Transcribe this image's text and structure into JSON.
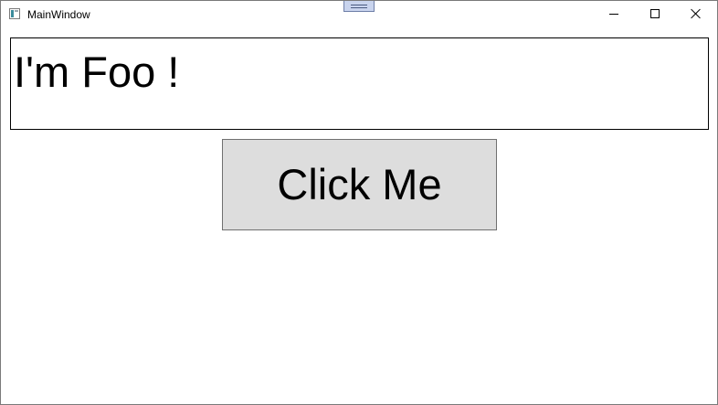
{
  "window": {
    "title": "MainWindow",
    "icon": "app-window-icon",
    "controls": {
      "minimize_icon": "minimize-icon",
      "maximize_icon": "maximize-icon",
      "close_icon": "close-icon"
    }
  },
  "main": {
    "textbox_value": "I'm Foo !",
    "button_label": "Click Me"
  },
  "colors": {
    "button_bg": "#dddddd",
    "grip_bg": "#c9d4ee"
  }
}
